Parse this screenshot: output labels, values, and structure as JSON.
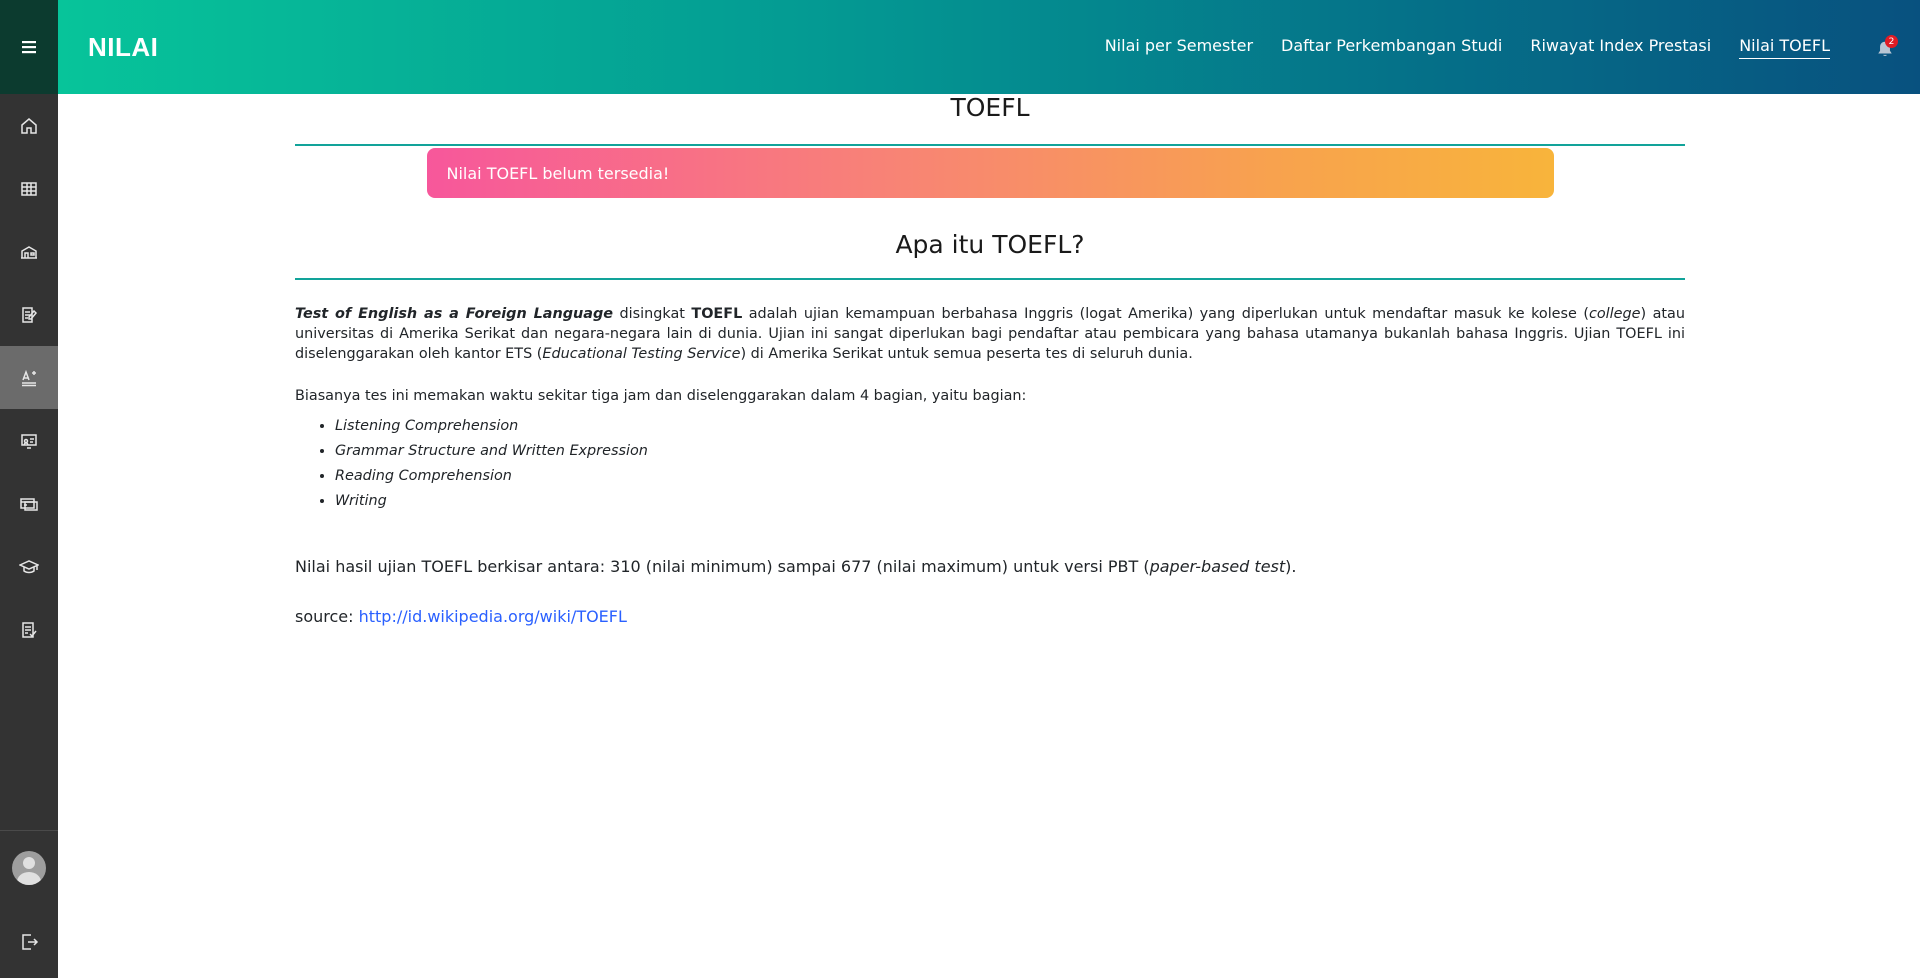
{
  "app": {
    "brand": "NILAI"
  },
  "nav": {
    "items": [
      {
        "label": "Nilai per Semester",
        "active": false
      },
      {
        "label": "Daftar Perkembangan Studi",
        "active": false
      },
      {
        "label": "Riwayat Index Prestasi",
        "active": false
      },
      {
        "label": "Nilai TOEFL",
        "active": true
      }
    ],
    "notification_count": "2"
  },
  "sidebar": {
    "items": [
      {
        "icon": "home-icon"
      },
      {
        "icon": "calendar-table-icon"
      },
      {
        "icon": "building-icon"
      },
      {
        "icon": "document-edit-icon"
      },
      {
        "icon": "font-grade-icon",
        "active": true
      },
      {
        "icon": "presentation-icon"
      },
      {
        "icon": "payment-icon"
      },
      {
        "icon": "graduation-cap-icon"
      },
      {
        "icon": "checklist-icon"
      }
    ],
    "bottom": [
      {
        "icon": "avatar"
      },
      {
        "icon": "logout-icon"
      }
    ]
  },
  "main": {
    "title": "TOEFL",
    "alert": "Nilai TOEFL belum tersedia!",
    "section_title": "Apa itu TOEFL?",
    "intro": {
      "term": "Test of English as a Foreign Language",
      "t1": " disingkat ",
      "abbr": "TOEFL",
      "t2": " adalah ujian kemampuan berbahasa Inggris (logat Amerika) yang diperlukan untuk mendaftar masuk ke kolese (",
      "college": "college",
      "t3": ") atau universitas di Amerika Serikat dan negara-negara lain di dunia. Ujian ini sangat diperlukan bagi pendaftar atau pembicara yang bahasa utamanya bukanlah bahasa Inggris. Ujian TOEFL ini diselenggarakan oleh kantor ETS (",
      "ets": "Educational Testing Service",
      "t4": ") di Amerika Serikat untuk semua peserta tes di seluruh dunia."
    },
    "parts_intro": "Biasanya tes ini memakan waktu sekitar tiga jam dan diselenggarakan dalam 4 bagian, yaitu bagian:",
    "parts": [
      "Listening Comprehension",
      "Grammar Structure and Written Expression",
      "Reading Comprehension",
      "Writing"
    ],
    "range": {
      "text": "Nilai hasil ujian TOEFL berkisar antara: 310 (nilai minimum) sampai 677 (nilai maximum) untuk versi PBT (",
      "pbt": "paper-based test",
      "end": ")."
    },
    "source": {
      "label": "source: ",
      "link": "http://id.wikipedia.org/wiki/TOEFL"
    }
  },
  "colors": {
    "topbar_gradient": [
      "#07c49a",
      "#08517f"
    ],
    "sidebar": "#333333",
    "divider": "#12a39a",
    "alert_gradient": [
      "#f7579b",
      "#f8b43b"
    ],
    "link": "#2a60ff",
    "badge": "#e01b24"
  }
}
